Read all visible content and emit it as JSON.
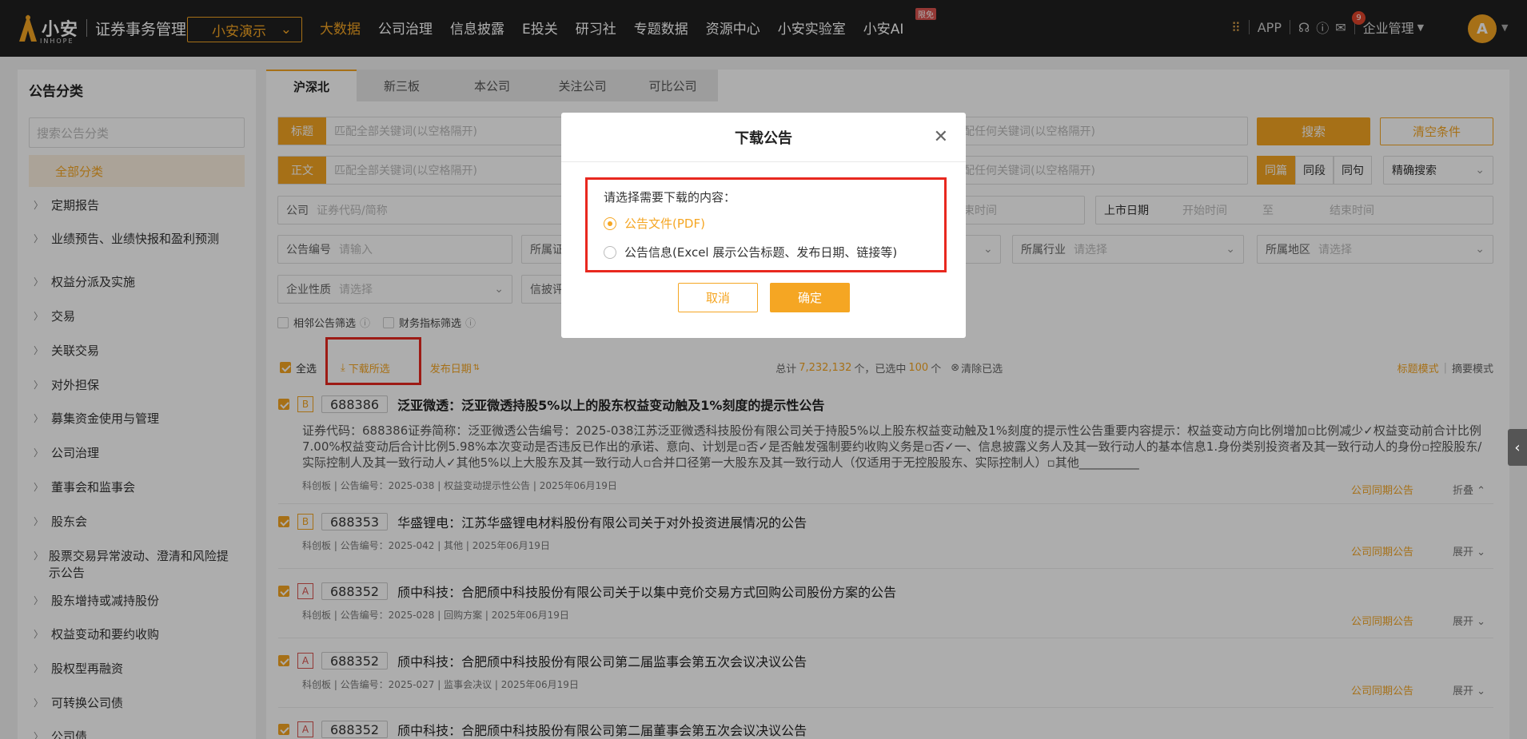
{
  "header": {
    "brand": "小安",
    "brand_sub": "INHOPE",
    "product": "证券事务管理",
    "tenant": "小安演示",
    "nav": [
      "大数据",
      "公司治理",
      "信息披露",
      "E投关",
      "研习社",
      "专题数据",
      "资源中心",
      "小安实验室",
      "小安AI"
    ],
    "nav_badge": "限免",
    "app_label": "APP",
    "notif_count": "9",
    "company_menu": "企业管理",
    "avatar_letter": "A"
  },
  "sidebar": {
    "title": "公告分类",
    "search_placeholder": "搜索公告分类",
    "all_label": "全部分类",
    "items": [
      "定期报告",
      "业绩预告、业绩快报和盈利预测",
      "权益分派及实施",
      "交易",
      "关联交易",
      "对外担保",
      "募集资金使用与管理",
      "公司治理",
      "董事会和监事会",
      "股东会",
      "股票交易异常波动、澄清和风险提示公告",
      "股东增持或减持股份",
      "权益变动和要约收购",
      "股权型再融资",
      "可转换公司债",
      "公司债"
    ]
  },
  "tabs": [
    "沪深北",
    "新三板",
    "本公司",
    "关注公司",
    "可比公司"
  ],
  "filters": {
    "title_label": "标题",
    "title_ph": "匹配全部关键词(以空格隔开)",
    "title_any_ph": "匹配任何关键词(以空格隔开)",
    "body_label": "正文",
    "body_ph": "匹配全部关键词(以空格隔开)",
    "body_any_ph": "匹配任何关键词(以空格隔开)",
    "search_btn": "搜索",
    "clear_btn": "清空条件",
    "seg": [
      "同篇",
      "同段",
      "同句"
    ],
    "exact": "精确搜索",
    "company_label": "公司",
    "company_ph": "证券代码/简称",
    "pubtime_ph": "结束时间",
    "list_label": "上市日期",
    "start_ph": "开始时间",
    "to": "至",
    "end_ph": "结束时间",
    "code_label": "公告编号",
    "code_ph": "请输入",
    "market_label": "所属证",
    "industry_label": "所属行业",
    "industry_ph": "请选择",
    "region_label": "所属地区",
    "region_ph": "请选择",
    "nature_label": "企业性质",
    "nature_ph": "请选择",
    "disc_label": "信披评",
    "adj_label": "相邻公告筛选",
    "fin_label": "财务指标筛选"
  },
  "listbar": {
    "select_all": "全选",
    "download": "下载所选",
    "sort": "发布日期",
    "total_pre": "总计",
    "total": "7,232,132",
    "total_mid": "个，已选中",
    "selected": "100",
    "total_post": "个",
    "clear": "清除已选",
    "mode1": "标题模式",
    "mode2": "摘要模式"
  },
  "rows": [
    {
      "grade": "B",
      "code": "688386",
      "title": "泛亚微透：泛亚微透持股5%以上的股东权益变动触及1%刻度的提示性公告",
      "bold": true,
      "desc": "证券代码：688386证券简称：泛亚微透公告编号：2025-038江苏泛亚微透科技股份有限公司关于持股5%以上股东权益变动触及1%刻度的提示性公告重要内容提示：权益变动方向比例增加▫比例减少✓权益变动前合计比例7.00%权益变动后合计比例5.98%本次变动是否违反已作出的承诺、意向、计划是▫否✓是否触发强制要约收购义务是▫否✓一、信息披露义务人及其一致行动人的基本信息1.身份类别投资者及其一致行动人的身份▫控股股东/实际控制人及其一致行动人✓其他5%以上大股东及其一致行动人▫合并口径第一大股东及其一致行动人（仅适用于无控股股东、实际控制人）▫其他__________",
      "meta": "科创板 | 公告编号：2025-038 | 权益变动提示性公告 | 2025年06月19日",
      "link": "公司同期公告",
      "toggle": "折叠"
    },
    {
      "grade": "B",
      "code": "688353",
      "title": "华盛锂电：江苏华盛锂电材料股份有限公司关于对外投资进展情况的公告",
      "meta": "科创板 | 公告编号：2025-042 | 其他 | 2025年06月19日",
      "link": "公司同期公告",
      "toggle": "展开"
    },
    {
      "grade": "A",
      "code": "688352",
      "title": "颀中科技：合肥颀中科技股份有限公司关于以集中竞价交易方式回购公司股份方案的公告",
      "meta": "科创板 | 公告编号：2025-028 | 回购方案 | 2025年06月19日",
      "link": "公司同期公告",
      "toggle": "展开"
    },
    {
      "grade": "A",
      "code": "688352",
      "title": "颀中科技：合肥颀中科技股份有限公司第二届监事会第五次会议决议公告",
      "meta": "科创板 | 公告编号：2025-027 | 监事会决议 | 2025年06月19日",
      "link": "公司同期公告",
      "toggle": "展开"
    },
    {
      "grade": "A",
      "code": "688352",
      "title": "颀中科技：合肥颀中科技股份有限公司第二届董事会第五次会议决议公告"
    }
  ],
  "modal": {
    "title": "下载公告",
    "prompt": "请选择需要下载的内容：",
    "opt1": "公告文件(PDF)",
    "opt2": "公告信息(Excel 展示公告标题、发布日期、链接等)",
    "cancel": "取消",
    "ok": "确定"
  }
}
